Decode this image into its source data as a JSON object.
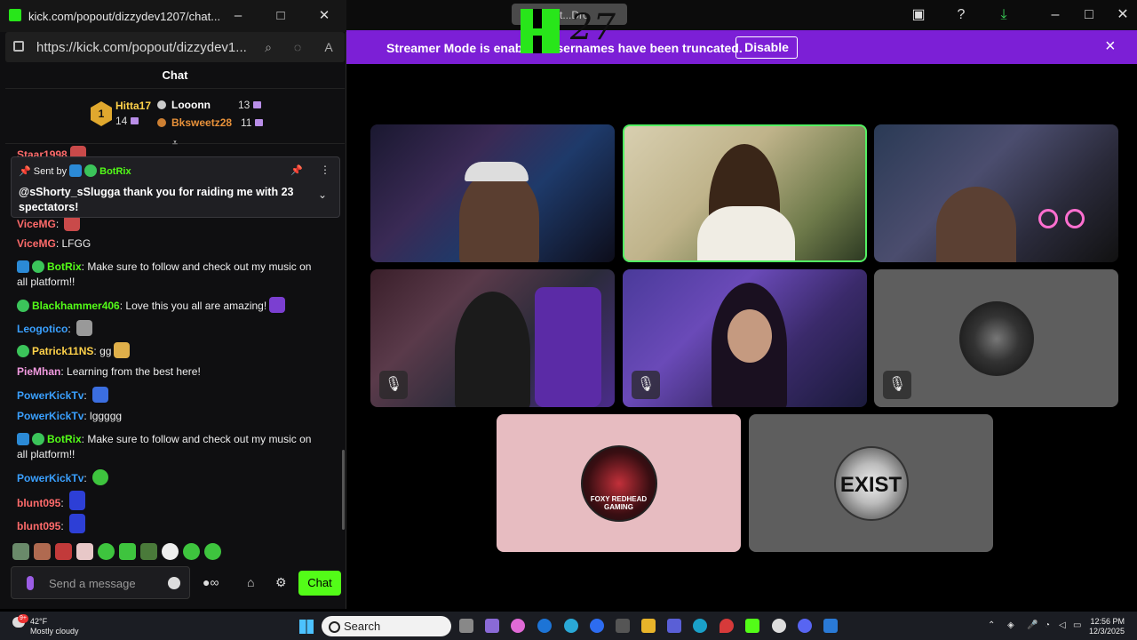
{
  "app": {
    "faded_tab_label": "Butt...Dro",
    "overlay_logo_text": "27"
  },
  "banner": {
    "message": "Streamer Mode is enabled. Usernames have been truncated.",
    "disable_label": "Disable",
    "close": "×"
  },
  "chat_window": {
    "title": "kick.com/popout/dizzydev1207/chat...",
    "url": "https://kick.com/popout/dizzydev1...",
    "header": "Chat",
    "leaderboard": {
      "rank_badge": "1",
      "first": {
        "name": "Hitta17",
        "count": "14"
      },
      "second": {
        "name": "Looonn",
        "count": "13"
      },
      "third": {
        "name": "Bksweetz28",
        "count": "11"
      }
    },
    "pinned": {
      "sent_by_prefix": "Sent by",
      "sender": "BotRix",
      "text": "@sShorty_sSlugga thank you for raiding me with 23 spectators!"
    },
    "partial_top_user": "Staar1998",
    "messages": [
      {
        "user": "ViceMG",
        "text": "",
        "color": "#ff6b6b",
        "emote_color": "#c94a4a"
      },
      {
        "user": "ViceMG",
        "text": "LFGG",
        "color": "#ff6b6b"
      },
      {
        "user": "BotRix",
        "text": "Make sure to follow and check out my music on all platform!!",
        "color": "#53fc18"
      },
      {
        "user": "Blackhammer406",
        "text": "Love this you all are amazing!",
        "color": "#53fc18",
        "emote_color": "#7b3fd1"
      },
      {
        "user": "Leogotico",
        "text": "",
        "color": "#3aa0ff",
        "emote_color": "#999999"
      },
      {
        "user": "Patrick11NS",
        "text": "gg",
        "color": "#ffd24a",
        "emote_color": "#e0b04a"
      },
      {
        "user": "PieMhan",
        "text": "Learning from the best here!",
        "color": "#f29ae0"
      },
      {
        "user": "PowerKickTv",
        "text": "",
        "color": "#3aa0ff",
        "emote_color": "#3b6ee0"
      },
      {
        "user": "PowerKickTv",
        "text": "lggggg",
        "color": "#3aa0ff"
      },
      {
        "user": "BotRix",
        "text": "Make sure to follow and check out my music on all platform!!",
        "color": "#53fc18"
      },
      {
        "user": "PowerKickTv",
        "text": "",
        "color": "#3aa0ff",
        "emote_color": "#3ec43e"
      },
      {
        "user": "blunt095",
        "text": "",
        "color": "#ff6b6b",
        "emote_color": "#2d3fd6"
      },
      {
        "user": "blunt095",
        "text": "",
        "color": "#ff6b6b",
        "emote_color": "#2d3fd6"
      }
    ],
    "input_placeholder": "Send a message",
    "send_label": "Chat"
  },
  "video_tiles": [
    {
      "label": "streamer-1",
      "muted": false,
      "active": false
    },
    {
      "label": "streamer-2",
      "muted": false,
      "active": true
    },
    {
      "label": "streamer-3",
      "muted": false,
      "active": false
    },
    {
      "label": "streamer-4",
      "muted": true,
      "active": false
    },
    {
      "label": "streamer-5",
      "muted": true,
      "active": false
    },
    {
      "label": "streamer-6",
      "muted": true,
      "active": false
    },
    {
      "label": "foxy-redhead",
      "muted": false,
      "active": false,
      "avatar_text": "FOXY REDHEAD GAMING"
    },
    {
      "label": "exist",
      "muted": false,
      "active": false,
      "avatar_text": "EXIST"
    }
  ],
  "taskbar": {
    "temperature": "42°F",
    "weather": "Mostly cloudy",
    "weather_badge": "9+",
    "search_label": "Search",
    "time": "12:56 PM",
    "date": "12/3/2025"
  }
}
